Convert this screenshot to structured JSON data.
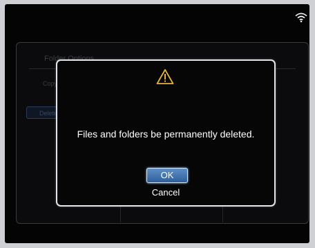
{
  "background_dialog": {
    "title": "Folder Options",
    "label": "Copy",
    "button": "Delete"
  },
  "dialog": {
    "icon": "warning-icon",
    "message": "Files and folders be permanently deleted.",
    "ok_label": "OK",
    "cancel_label": "Cancel",
    "accent": "#4a7bb5"
  },
  "status": {
    "icon": "wifi-icon"
  }
}
